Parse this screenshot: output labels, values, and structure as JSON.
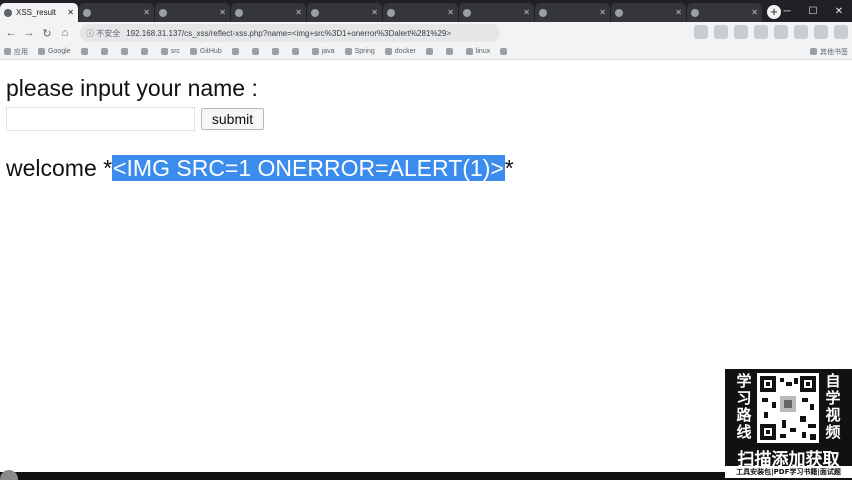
{
  "browser": {
    "tabs": [
      {
        "label": "XSS_result",
        "active": true
      },
      {
        "label": "",
        "active": false
      },
      {
        "label": "",
        "active": false
      },
      {
        "label": "",
        "active": false
      },
      {
        "label": "",
        "active": false
      },
      {
        "label": "",
        "active": false
      },
      {
        "label": "",
        "active": false
      },
      {
        "label": "",
        "active": false
      },
      {
        "label": "",
        "active": false
      },
      {
        "label": "",
        "active": false
      }
    ],
    "new_tab": "+",
    "security_label": "不安全",
    "url": "192.168.31.137/cs_xss/reflect-xss.php?name=<img+src%3D1+onerror%3Dalert%281%29>",
    "bookmarks": [
      "应用",
      "Google",
      "",
      "",
      "",
      "",
      "src",
      "GitHub",
      "",
      "",
      "",
      "",
      "java",
      "Spring",
      "docker",
      "",
      "",
      "linux",
      ""
    ],
    "other_bookmarks": "其他书签"
  },
  "page": {
    "prompt": "please input your name :",
    "input_value": "",
    "submit_label": "submit",
    "welcome_prefix": "welcome *",
    "welcome_selected": "<IMG SRC=1 ONERROR=ALERT(1)>",
    "welcome_suffix": "*"
  },
  "promo": {
    "left_chars": [
      "学",
      "习",
      "路",
      "线"
    ],
    "right_chars": [
      "自",
      "学",
      "视",
      "频"
    ],
    "cta": "扫描添加获取",
    "sub": "工具安装包|PDF学习书籍|面试题"
  },
  "colors": {
    "selection": "#3b8ced",
    "chrome_dark": "#202124",
    "chrome_light": "#f1f3f4"
  }
}
